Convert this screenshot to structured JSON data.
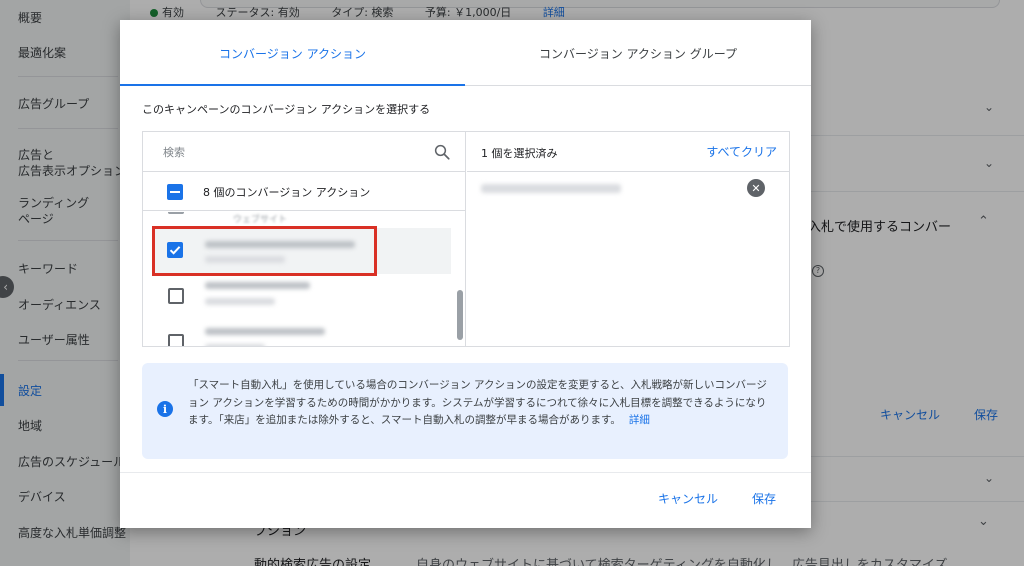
{
  "sidebar": {
    "items": [
      {
        "label": "概要"
      },
      {
        "label": "最適化案"
      },
      {
        "label": "広告グループ"
      },
      {
        "label": "広告と\n広告表示オプション"
      },
      {
        "label": "ランディング\nページ"
      },
      {
        "label": "キーワード"
      },
      {
        "label": "オーディエンス"
      },
      {
        "label": "ユーザー属性"
      },
      {
        "label": "設定"
      },
      {
        "label": "地域"
      },
      {
        "label": "広告のスケジュール"
      },
      {
        "label": "デバイス"
      },
      {
        "label": "高度な入札単価調整"
      }
    ],
    "active": "設定"
  },
  "background": {
    "status": {
      "enabled": "有効",
      "status_text": "ステータス: 有効",
      "type_text": "タイプ: 検索",
      "budget_text": "予算: ￥1,000/日",
      "details_link": "詳細"
    },
    "bidding_section_title": "入札で使用するコンバー",
    "cancel": "キャンセル",
    "save": "保存",
    "section_partial": "ブション",
    "dsa_label": "動的検索広告の設定",
    "dsa_desc": "自身のウェブサイトに基づいて検索ターゲティングを自動化し、広告見出しをカスタマイズ"
  },
  "dialog": {
    "tabs": [
      {
        "label": "コンバージョン アクション",
        "active": true
      },
      {
        "label": "コンバージョン アクション グループ",
        "active": false
      }
    ],
    "subtitle": "このキャンペーンのコンバージョン アクションを選択する",
    "search": {
      "placeholder": "検索"
    },
    "select_all_label": "8 個のコンバージョン アクション",
    "select_all_state": "indeterminate",
    "partial_item_text": "ウェブサイト",
    "list_items": [
      {
        "checked": true
      },
      {
        "checked": false
      },
      {
        "checked": false
      }
    ],
    "selected_count": "1 個を選択済み",
    "clear_all": "すべてクリア",
    "info": {
      "text": "「スマート自動入札」を使用している場合のコンバージョン アクションの設定を変更すると、入札戦略が新しいコンバージョン アクションを学習するための時間がかかります。システムが学習するにつれて徐々に入札目標を調整できるようになります。「来店」を追加または除外すると、スマート自動入札の調整が早まる場合があります。",
      "link": "詳細"
    },
    "cancel_label": "キャンセル",
    "save_label": "保存"
  },
  "colors": {
    "accent": "#1a73e8",
    "highlight": "#d93025",
    "scrim": "rgba(0,0,0,0.32)"
  },
  "icons": [
    "search-icon",
    "remove-icon",
    "info-icon",
    "chevron-down-icon",
    "chevron-up-icon",
    "chevron-left-icon",
    "help-icon"
  ]
}
